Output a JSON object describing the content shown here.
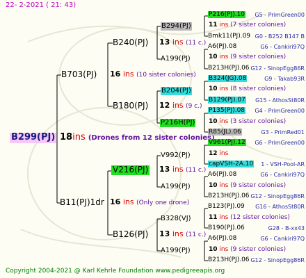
{
  "header": {
    "date": "22-  2-2021  ( 21: 43)"
  },
  "footer": {
    "copyright": "Copyright 2004-2021 @ Karl Kehrle Foundation    www.pedigreeapis.org"
  },
  "colors": {
    "green": "#22dd22",
    "cyan": "#33dddd",
    "gray": "#b8b8b8",
    "pink": "#f7c8f7",
    "ins_red": "#e00000",
    "note_purple": "#6010a0",
    "info_blue": "#2a2aa8"
  },
  "root": {
    "name": "B299(PJ)",
    "ins_value": "18",
    "ins_unit": "ins",
    "note": "(Drones from 12 sister colonies)"
  },
  "gen1": [
    {
      "name": "B703(PJ)",
      "ins_value": "16",
      "ins_unit": "ins",
      "note": "(10 sister colonies)"
    },
    {
      "name": "B11(PJ)1dr",
      "ins_value": "16",
      "ins_unit": "ins",
      "note": "(Only one drone)"
    }
  ],
  "gen2": [
    {
      "name": "B240(PJ)",
      "ins_value": "13",
      "ins_unit": "ins",
      "note": "(11 c.)"
    },
    {
      "name": "B180(PJ)",
      "ins_value": "12",
      "ins_unit": "ins",
      "note": "(9 c.)"
    },
    {
      "name": "V216(PJ)",
      "ins_value": "13",
      "ins_unit": "ins",
      "note": "(11 c.)"
    },
    {
      "name": "B126(PJ)",
      "ins_value": "13",
      "ins_unit": "ins",
      "note": "(11 c.)"
    }
  ],
  "gen3": [
    {
      "name": "B294(PJ)"
    },
    {
      "name": "A199(PJ)"
    },
    {
      "name": "B204(PJ)"
    },
    {
      "name": "P216H(PJ)"
    },
    {
      "name": "V992(PJ)"
    },
    {
      "name": "A199(PJ)"
    },
    {
      "name": "B328(VJ)"
    },
    {
      "name": "A199(PJ)"
    }
  ],
  "gen4": [
    {
      "kind": "node",
      "name": "P216(PJ).10",
      "hl": "green",
      "info": "G5 - PrimGreen00"
    },
    {
      "kind": "ins",
      "value": "11",
      "unit": "ins",
      "note": "(7 sister colonies)"
    },
    {
      "kind": "node",
      "name": "Bmk11(PJ).09",
      "hl": "",
      "info": "G0 - B252 B147 B"
    },
    {
      "kind": "node",
      "name": "A6(PJ).08",
      "hl": "",
      "info": "G6 - Cankiri97Q"
    },
    {
      "kind": "ins",
      "value": "10",
      "unit": "ins",
      "note": "(9 sister colonies)"
    },
    {
      "kind": "node",
      "name": "B213H(PJ).06",
      "hl": "",
      "info": "G12 - SinopEgg86R"
    },
    {
      "kind": "node",
      "name": "B324(JG).08",
      "hl": "cyan",
      "info": "G9 - Takab93R"
    },
    {
      "kind": "ins",
      "value": "10",
      "unit": "ins",
      "note": "(8 sister colonies)"
    },
    {
      "kind": "node",
      "name": "B129(PJ).07",
      "hl": "cyan",
      "info": "G15 - AthosSt80R"
    },
    {
      "kind": "node",
      "name": "P135(PJ).08",
      "hl": "cyan",
      "info": "G4 - PrimGreen00"
    },
    {
      "kind": "ins",
      "value": "10",
      "unit": "ins",
      "note": "(3 sister colonies)"
    },
    {
      "kind": "node",
      "name": "R85(JL).06",
      "hl": "gray",
      "info": "G3 - PrimRed01"
    },
    {
      "kind": "node",
      "name": "V961(PJ).12",
      "hl": "green",
      "info": "G6 - PrimGreen00"
    },
    {
      "kind": "ins",
      "value": "12",
      "unit": "ins",
      "note": ""
    },
    {
      "kind": "node",
      "name": "capVSH-2A.10",
      "hl": "cyan",
      "info": "1 - VSH-Pool-AR"
    },
    {
      "kind": "node",
      "name": "A6(PJ).08",
      "hl": "",
      "info": "G6 - Cankiri97Q"
    },
    {
      "kind": "ins",
      "value": "10",
      "unit": "ins",
      "note": "(9 sister colonies)"
    },
    {
      "kind": "node",
      "name": "B213H(PJ).06",
      "hl": "",
      "info": "G12 - SinopEgg86R"
    },
    {
      "kind": "node",
      "name": "B123(PJ).09",
      "hl": "",
      "info": "G16 - AthosSt80R"
    },
    {
      "kind": "ins",
      "value": "11",
      "unit": "ins",
      "note": "(12 sister colonies)"
    },
    {
      "kind": "node",
      "name": "B190(PJ).06",
      "hl": "",
      "info": "G28 - B-xx43"
    },
    {
      "kind": "node",
      "name": "A6(PJ).08",
      "hl": "",
      "info": "G6 - Cankiri97Q"
    },
    {
      "kind": "ins",
      "value": "10",
      "unit": "ins",
      "note": "(9 sister colonies)"
    },
    {
      "kind": "node",
      "name": "B213H(PJ).06",
      "hl": "",
      "info": "G12 - SinopEgg86R"
    }
  ]
}
